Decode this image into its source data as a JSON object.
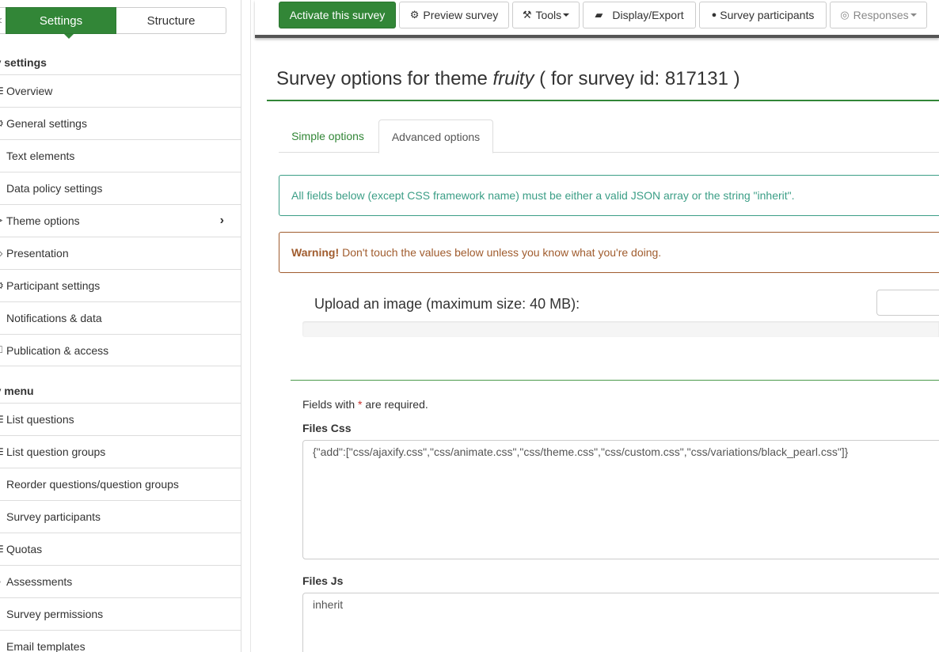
{
  "sidebar": {
    "tabs": {
      "collapse": "<",
      "settings": "Settings",
      "structure": "Structure"
    },
    "survey_settings_heading": "vey settings",
    "settings_items": [
      {
        "icon": "list-icon",
        "glyph": "☰",
        "label": "Overview"
      },
      {
        "icon": "gears-icon",
        "glyph": "⚙",
        "label": "General settings"
      },
      {
        "icon": "file-text-icon",
        "glyph": "▯",
        "label": "Text elements"
      },
      {
        "icon": "shield-icon",
        "glyph": "▮",
        "label": "Data policy settings"
      },
      {
        "icon": "paint-brush-icon",
        "glyph": "✒",
        "label": "Theme options"
      },
      {
        "icon": "eye-icon",
        "glyph": "◇",
        "label": "Presentation"
      },
      {
        "icon": "user-gear-icon",
        "glyph": "⚙",
        "label": "Participant settings"
      },
      {
        "icon": "bell-icon",
        "glyph": "▴",
        "label": "Notifications & data"
      },
      {
        "icon": "key-icon",
        "glyph": "⚿",
        "label": "Publication & access"
      }
    ],
    "survey_menu_heading": "vey menu",
    "menu_items": [
      {
        "icon": "list-icon",
        "glyph": "☰",
        "label": "List questions"
      },
      {
        "icon": "list-icon",
        "glyph": "☰",
        "label": "List question groups"
      },
      {
        "icon": "sort-icon",
        "glyph": "↕",
        "label": "Reorder questions/question groups"
      },
      {
        "icon": "users-icon",
        "glyph": "▮",
        "label": "Survey participants"
      },
      {
        "icon": "tasks-icon",
        "glyph": "☰",
        "label": "Quotas"
      },
      {
        "icon": "comment-icon",
        "glyph": "○",
        "label": "Assessments"
      },
      {
        "icon": "lock-icon",
        "glyph": " ",
        "label": "Survey permissions"
      },
      {
        "icon": "envelope-icon",
        "glyph": "▯",
        "label": "Email templates"
      }
    ]
  },
  "toolbar": {
    "activate": "Activate this survey",
    "preview": "Preview survey",
    "tools": "Tools",
    "display_export": "Display/Export",
    "participants": "Survey participants",
    "responses": "Responses"
  },
  "page": {
    "title_prefix": "Survey options for theme ",
    "theme_name": "fruity",
    "title_suffix": " ( for survey id: 817131 )"
  },
  "tabs": {
    "simple": "Simple options",
    "advanced": "Advanced options"
  },
  "alerts": {
    "info": "All fields below (except CSS framework name) must be either a valid JSON array or the string \"inherit\".",
    "warning_strong": "Warning!",
    "warning_text": "Don't touch the values below unless you know what you're doing."
  },
  "upload": {
    "label": "Upload an image (maximum size: 40 MB):"
  },
  "form": {
    "required_prefix": "Fields with ",
    "required_mark": "*",
    "required_suffix": " are required.",
    "files_css_label": "Files Css",
    "files_css_value": "{\"add\":[\"css/ajaxify.css\",\"css/animate.css\",\"css/theme.css\",\"css/custom.css\",\"css/variations/black_pearl.css\"]}",
    "files_js_label": "Files Js",
    "files_js_value": "inherit"
  },
  "colors": {
    "brand_green": "#328637",
    "info": "#3b9e86",
    "warning": "#a05c2e",
    "required": "#c9302c"
  }
}
